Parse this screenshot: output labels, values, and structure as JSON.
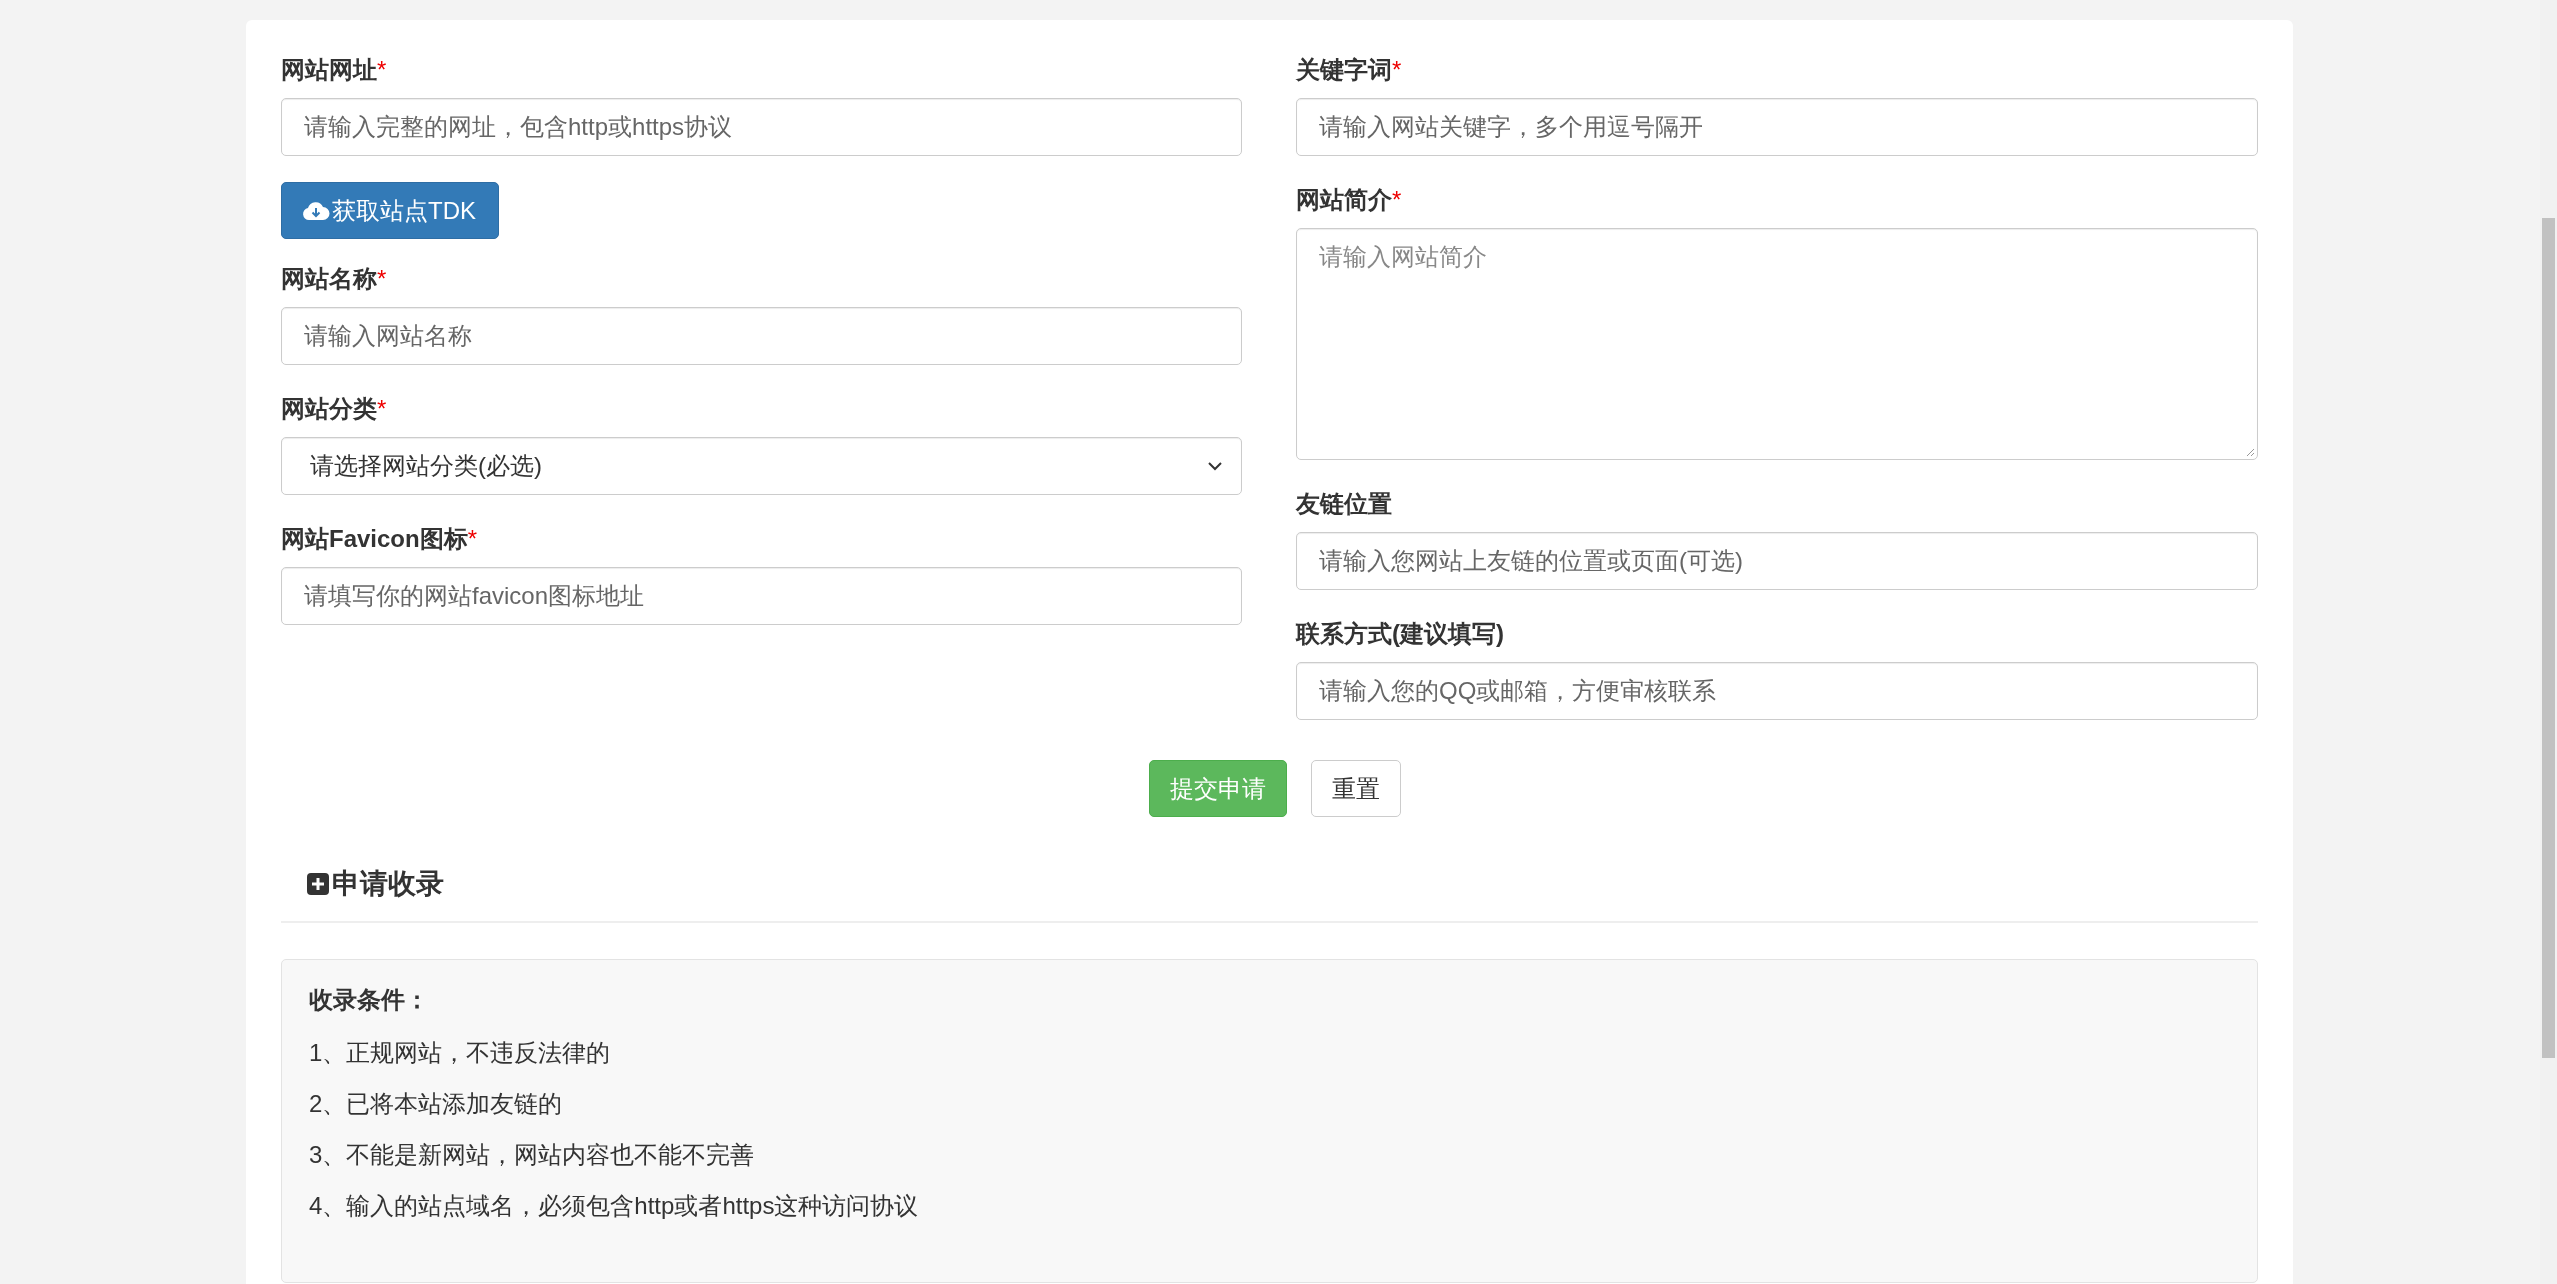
{
  "left_fields": [
    {
      "kind": "input",
      "label": "网站网址",
      "required_mark": "*",
      "placeholder": "请输入完整的网址，包含http或https协议"
    },
    {
      "kind": "button",
      "label": "获取站点TDK"
    },
    {
      "kind": "input",
      "label": "网站名称",
      "required_mark": "*",
      "placeholder": "请输入网站名称"
    },
    {
      "kind": "select",
      "label": "网站分类",
      "required_mark": "*",
      "value": "请选择网站分类(必选)"
    },
    {
      "kind": "input",
      "label": "网站Favicon图标",
      "required_mark": "*",
      "placeholder": "请填写你的网站favicon图标地址"
    }
  ],
  "right_fields": [
    {
      "kind": "input",
      "label": "关键字词",
      "required_mark": "*",
      "placeholder": "请输入网站关键字，多个用逗号隔开"
    },
    {
      "kind": "textarea",
      "label": "网站简介",
      "required_mark": "*",
      "placeholder": "请输入网站简介"
    },
    {
      "kind": "input",
      "label": "友链位置",
      "placeholder": "请输入您网站上友链的位置或页面(可选)"
    },
    {
      "kind": "input",
      "label": "联系方式(建议填写)",
      "placeholder": "请输入您的QQ或邮箱，方便审核联系"
    }
  ],
  "actions": [
    {
      "kind": "primary",
      "label": "提交申请"
    },
    {
      "kind": "default",
      "label": "重置"
    }
  ],
  "section": {
    "title": "申请收录"
  },
  "conditions": {
    "title": "收录条件：",
    "items": [
      "1、正规网站，不违反法律的",
      "2、已将本站添加友链的",
      "3、不能是新网站，网站内容也不能不完善",
      "4、输入的站点域名，必须包含http或者https这种访问协议"
    ]
  }
}
